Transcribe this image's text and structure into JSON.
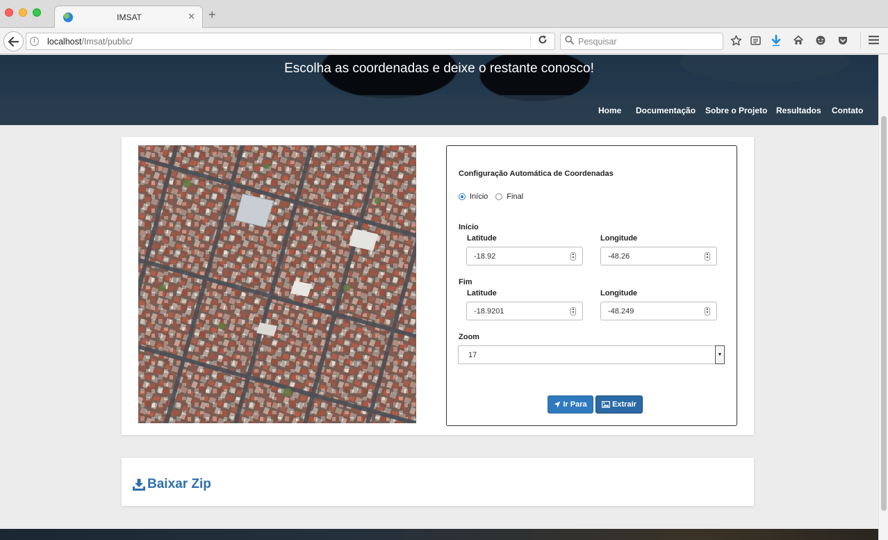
{
  "browser": {
    "tab_title": "IMSAT",
    "url_host": "localhost",
    "url_path": "/Imsat/public/",
    "search_placeholder": "Pesquisar"
  },
  "header": {
    "title": "Escolha as coordenadas e deixe o restante conosco!",
    "nav": [
      "Home",
      "Documentação",
      "Sobre o Projeto",
      "Resultados",
      "Contato"
    ]
  },
  "config": {
    "title": "Configuração Automática de Coordenadas",
    "radio_options": [
      {
        "label": "Início",
        "checked": true
      },
      {
        "label": "Final",
        "checked": false
      }
    ],
    "start": {
      "label": "Início",
      "latitude_label": "Latitude",
      "latitude_value": "-18.92",
      "longitude_label": "Longitude",
      "longitude_value": "-48.26"
    },
    "end": {
      "label": "Fim",
      "latitude_label": "Latitude",
      "latitude_value": "-18.9201",
      "longitude_label": "Longitude",
      "longitude_value": "-48.249"
    },
    "zoom_label": "Zoom",
    "zoom_value": "17",
    "goto_button": "Ir Para",
    "extract_button": "Extrair"
  },
  "download": {
    "label": "Baixar Zip"
  },
  "colors": {
    "primary": "#2f79bf",
    "link": "#2f6fac",
    "radio_accent": "#2a7fd6",
    "header_bg": "#22394d"
  },
  "icons": {
    "back": "arrow-left-icon",
    "info": "info-icon",
    "reload": "reload-icon",
    "search": "search-icon",
    "bookmark": "star-icon",
    "reader": "reader-icon",
    "download": "download-arrow-icon",
    "home": "home-icon",
    "chat": "chat-icon",
    "pocket": "pocket-icon",
    "menu": "hamburger-icon",
    "goto": "location-arrow-icon",
    "extract": "picture-icon",
    "zip": "download-icon"
  }
}
